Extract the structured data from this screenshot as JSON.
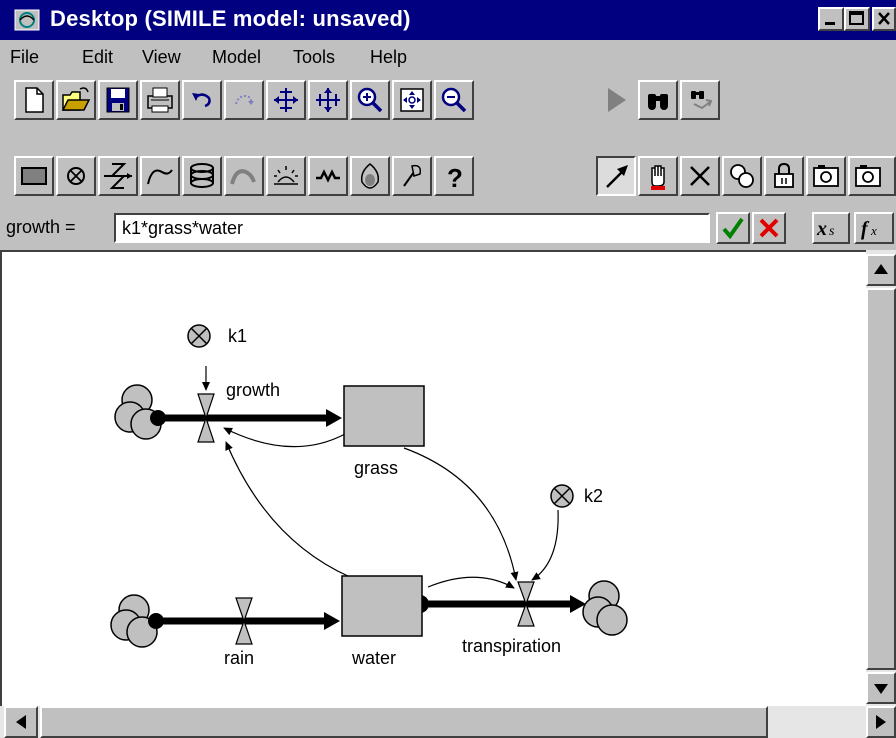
{
  "window": {
    "title": "Desktop (SIMILE model: unsaved)"
  },
  "menu": [
    "File",
    "Edit",
    "View",
    "Model",
    "Tools",
    "Help"
  ],
  "toolbar1": [
    "new",
    "open",
    "save",
    "print",
    "undo",
    "redo",
    "stretch-horizontal",
    "stretch-vertical",
    "zoom-in",
    "zoom-fit",
    "zoom-out",
    "run",
    "find",
    "find-replace"
  ],
  "toolbar2": [
    "compartment",
    "variable",
    "flow",
    "influence",
    "submodel",
    "role-arrow",
    "event",
    "function",
    "condition",
    "pin",
    "help",
    "select",
    "hand",
    "delete",
    "duplicate",
    "lock",
    "snapshot"
  ],
  "equation": {
    "label": "growth =",
    "value": "k1*grass*water"
  },
  "diagram": {
    "variables": [
      "k1",
      "k2"
    ],
    "compartments": [
      "grass",
      "water"
    ],
    "flows": [
      "growth",
      "rain",
      "transpiration"
    ]
  },
  "colors": {
    "titlebar": "#000080",
    "face": "#c0c0c0",
    "toolbar_icon": "#000080",
    "accept": "#008000",
    "reject": "#e00000"
  }
}
